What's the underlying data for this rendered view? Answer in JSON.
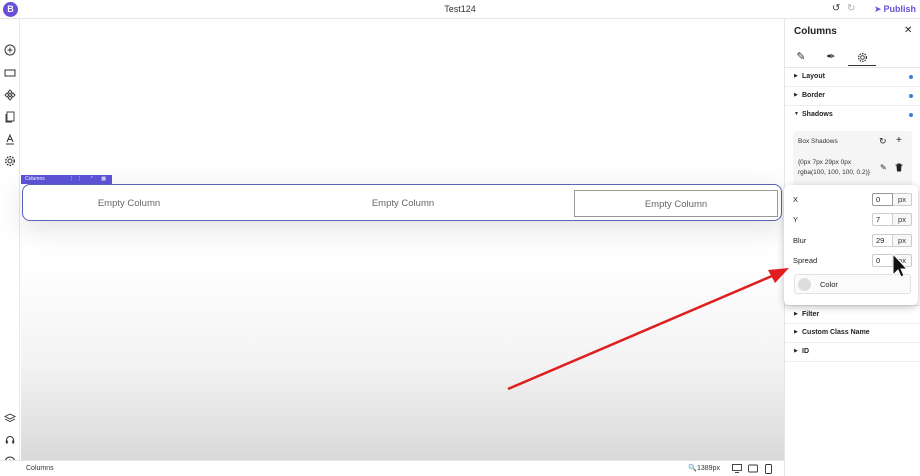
{
  "topbar": {
    "logo_text": "B",
    "title": "Test124",
    "undo_icon": "undo-icon",
    "redo_icon": "redo-icon",
    "publish_label": "Publish",
    "accent": "#6a4fd8"
  },
  "leftrail": {
    "icons": [
      "add-circle-icon",
      "section-icon",
      "components-icon",
      "pages-icon",
      "typography-icon",
      "settings-gear-icon",
      "layers-icon",
      "support-icon",
      "info-icon"
    ]
  },
  "canvas": {
    "columns_tag": "Columns",
    "columns": [
      {
        "label": "Empty Column"
      },
      {
        "label": "Empty Column"
      },
      {
        "label": "Empty Column"
      }
    ]
  },
  "bottombar": {
    "element_label": "Columns",
    "zoom": "1389px",
    "devices": [
      "desktop-icon",
      "tablet-icon",
      "mobile-icon"
    ]
  },
  "panel": {
    "title": "Columns",
    "tabs": [
      "pencil-icon",
      "brush-icon",
      "gear-icon"
    ],
    "sections": {
      "layout": "Layout",
      "border": "Border",
      "shadows": "Shadows",
      "filter": "Filter",
      "custom_class": "Custom Class Name",
      "id": "ID"
    },
    "box_shadows": {
      "header": "Box Shadows",
      "value": "{0px 7px 29px 0px rgba(100, 100, 100, 0.2)}"
    },
    "indicator_color": "#3b7ddd"
  },
  "popover": {
    "fields": [
      {
        "label": "X",
        "value": "0",
        "unit": "px"
      },
      {
        "label": "Y",
        "value": "7",
        "unit": "px"
      },
      {
        "label": "Blur",
        "value": "29",
        "unit": "px"
      },
      {
        "label": "Spread",
        "value": "0",
        "unit": "px"
      }
    ],
    "color_label": "Color"
  },
  "annotation": {
    "arrow_color": "#e01e1e"
  }
}
